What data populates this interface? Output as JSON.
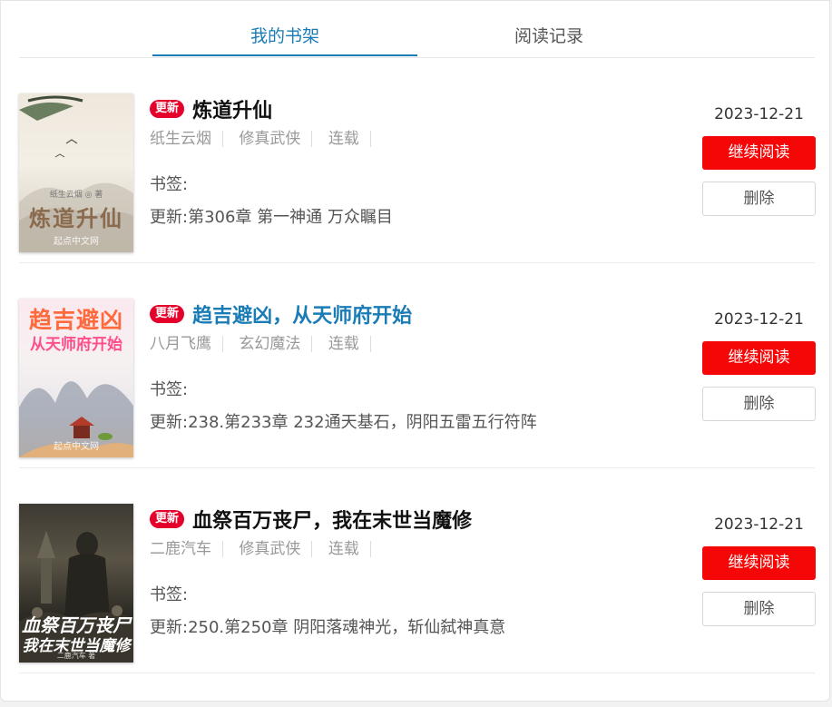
{
  "tabs": [
    {
      "label": "我的书架",
      "active": true
    },
    {
      "label": "阅读记录",
      "active": false
    }
  ],
  "badge_label": "更新",
  "bookmark_label": "书签:",
  "update_prefix": "更新:",
  "read_button_label": "继续阅读",
  "delete_button_label": "删除",
  "colors": {
    "accent": "#1a7cb6",
    "read_button": "#f50707",
    "badge": "#e4002b"
  },
  "books": [
    {
      "title": "炼道升仙",
      "author": "纸生云烟",
      "genre": "修真武侠",
      "status": "连载",
      "update": "第306章 第一神通 万众瞩目",
      "date": "2023-12-21",
      "cover": {
        "title": "炼道升仙",
        "author_line": "纸生云烟 ◎ 著",
        "watermark": "起点中文网"
      }
    },
    {
      "title": "趋吉避凶，从天师府开始",
      "author": "八月飞鹰",
      "genre": "玄幻魔法",
      "status": "连载",
      "update": "238.第233章 232通天基石，阴阳五雷五行符阵",
      "date": "2023-12-21",
      "cover": {
        "title": "趋吉避凶",
        "subtitle": "从天师府开始",
        "watermark": "起点中文网"
      }
    },
    {
      "title": "血祭百万丧尸，我在末世当魔修",
      "author": "二鹿汽车",
      "genre": "修真武侠",
      "status": "连载",
      "update": "250.第250章 阴阳落魂神光，斩仙弑神真意",
      "date": "2023-12-21",
      "cover": {
        "title": "血祭百万丧尸",
        "subtitle": "我在末世当魔修",
        "author_line": "二鹿汽车 著"
      }
    }
  ]
}
